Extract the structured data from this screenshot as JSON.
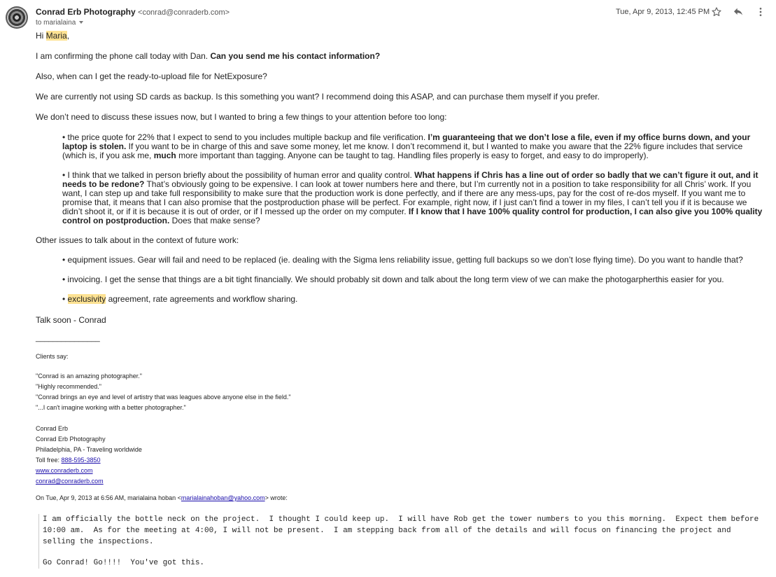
{
  "header": {
    "sender_name": "Conrad Erb Photography",
    "sender_email": "<conrad@conraderb.com>",
    "recipient": "to marialaina",
    "date": "Tue, Apr 9, 2013, 12:45 PM",
    "icons": [
      "star-icon",
      "reply-icon",
      "more-vert-icon"
    ]
  },
  "email": {
    "greeting_prefix": "Hi ",
    "greeting_name": "Maria",
    "greeting_suffix": ",",
    "p1_a": "I am confirming the phone call today with Dan. ",
    "p1_b": "Can you send me his contact information?",
    "p2": "Also, when can I get the ready-to-upload file for NetExposure?",
    "p3": "We are currently not using SD cards as backup. Is this something you want? I recommend doing this ASAP, and can purchase them myself if you prefer.",
    "p4": "We don’t need to discuss these issues now, but I wanted to bring a few things to your attention before too long:",
    "b1_a": "• the price quote for 22% that I expect to send to you includes multiple backup and file verification. ",
    "b1_b": "I’m guaranteeing that we don’t lose a file, even if my office burns down, and your laptop is stolen.",
    "b1_c": " If you want to be in charge of this and save some money, let me know. I don’t recommend it, but I wanted to make you aware that the 22% figure includes that service (which is, if you ask me, ",
    "b1_d": "much",
    "b1_e": " more important than tagging. Anyone can be taught to tag. Handling files properly is easy to forget, and easy to do improperly).",
    "b2_a": "• I think that we talked in person briefly about the possibility of human error and quality control. ",
    "b2_b": "What happens if Chris has a line out of order so badly that we can’t figure it out, and it needs to be redone?",
    "b2_c": " That’s obviously going to be expensive. I can look at tower numbers here and there, but I’m currently not in a position to take responsibility for all Chris’ work. If you want, I can step up and take full responsibility to make sure that the production work is done perfectly, and if there are any mess-ups, pay for the cost of re-dos myself. If you want me to promise that, it means that I can also promise that the postproduction phase will be perfect. For example, right now, if I just can’t find a tower in my files, I can’t tell you if it is because we didn’t shoot it, or if it is because it is out of order, or if I messed up the order on my computer. ",
    "b2_d": "If I know that I have 100% quality control for production, I can also give you 100% quality control on postproduction.",
    "b2_e": " Does that make sense?",
    "p5": "Other issues to talk about in the context of future work:",
    "b3": "• equipment issues. Gear will fail and need to be replaced (ie. dealing with the Sigma lens reliability issue, getting full backups so we don’t lose flying time). Do you want to handle that?",
    "b4": "• invoicing. I get the sense that things are a bit tight financially. We should probably sit down and talk about the long term view of we can make the photogarpherthis easier for you.",
    "b5_a": "• ",
    "b5_b": "exclusivity",
    "b5_c": " agreement, rate agreements and workflow sharing.",
    "closing": "Talk soon - Conrad"
  },
  "signature": {
    "rule": "_______________",
    "clients_say": "Clients say:",
    "quotes": [
      "\"Conrad is an amazing photographer.\"",
      "\"Highly recommended.\"",
      "\"Conrad brings an eye and level of artistry that was leagues above anyone else in the field.\"",
      "\"...I can't imagine working with a better photographer.\""
    ],
    "name": "Conrad Erb",
    "company": "Conrad Erb Photography",
    "location": "Philadelphia, PA - Traveling worldwide",
    "toll_free_label": "Toll free: ",
    "phone": "888-595-3850",
    "website": "www.conraderb.com",
    "email": "conrad@conraderb.com"
  },
  "quoted": {
    "intro_a": "On Tue, Apr 9, 2013 at 6:56 AM, marialaina hoban <",
    "intro_email": "marialainahoban@yahoo.com",
    "intro_b": "> wrote:",
    "text": "I am officially the bottle neck on the project.  I thought I could keep up.  I will have Rob get the tower numbers to you this morning.  Expect them before 10:00 am.  As for the meeting at 4:00, I will not be present.  I am stepping back from all of the details and will focus on financing the project and selling the inspections.",
    "text2": "Go Conrad! Go!!!!  You've got this."
  }
}
